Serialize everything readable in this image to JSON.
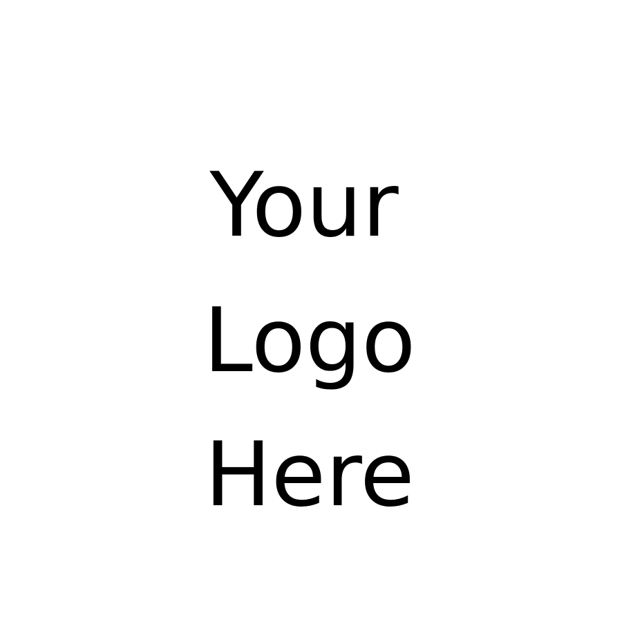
{
  "logo_placeholder": {
    "lines": [
      "Your",
      "Logo",
      "Here"
    ]
  },
  "colors": {
    "background": "#ffffff",
    "text": "#000000"
  }
}
